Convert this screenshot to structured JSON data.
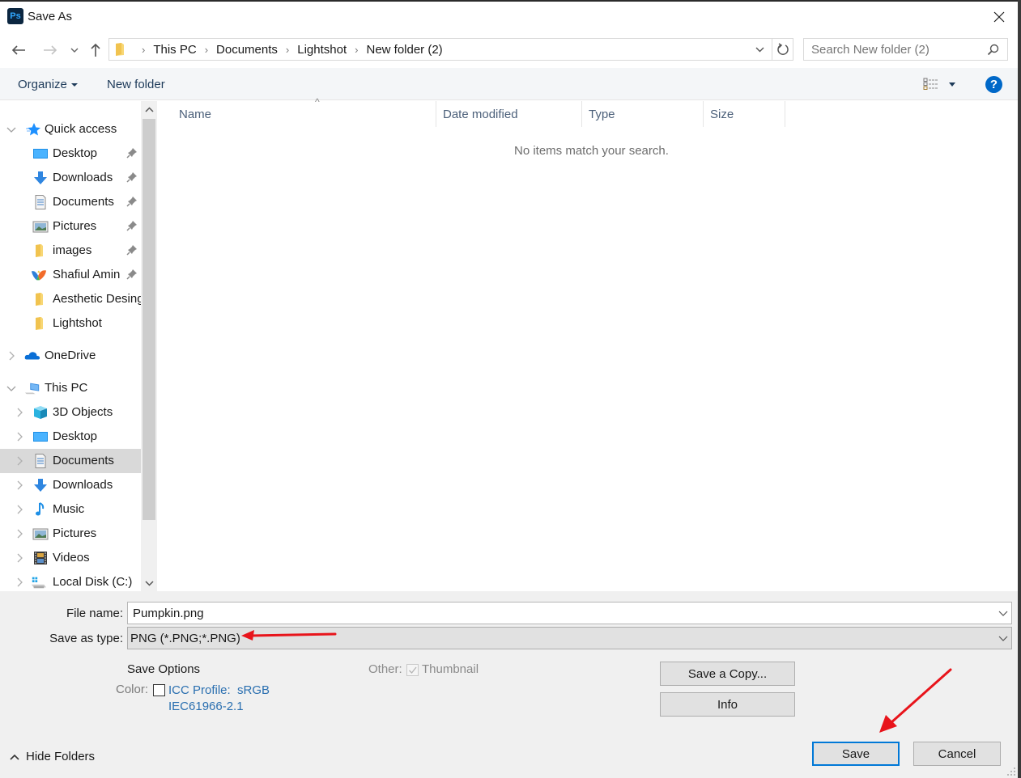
{
  "window": {
    "title": "Save As",
    "app_icon_text": "Ps"
  },
  "nav": {
    "breadcrumbs": [
      "This PC",
      "Documents",
      "Lightshot",
      "New folder (2)"
    ],
    "search_placeholder": "Search New folder (2)"
  },
  "toolbar": {
    "organize_label": "Organize",
    "new_folder_label": "New folder",
    "help_label": "?"
  },
  "sidebar": {
    "quick_access": {
      "label": "Quick access",
      "items": [
        {
          "label": "Desktop",
          "icon": "desktop-icon",
          "pinned": true
        },
        {
          "label": "Downloads",
          "icon": "downloads-icon",
          "pinned": true
        },
        {
          "label": "Documents",
          "icon": "documents-icon",
          "pinned": true
        },
        {
          "label": "Pictures",
          "icon": "pictures-icon",
          "pinned": true
        },
        {
          "label": "images",
          "icon": "folder-icon",
          "pinned": true
        },
        {
          "label": "Shafiul Amin",
          "icon": "user-folder-icon",
          "pinned": true
        },
        {
          "label": "Aesthetic Desing",
          "icon": "folder-icon",
          "pinned": false
        },
        {
          "label": "Lightshot",
          "icon": "folder-icon",
          "pinned": false
        }
      ]
    },
    "onedrive": {
      "label": "OneDrive"
    },
    "this_pc": {
      "label": "This PC",
      "items": [
        {
          "label": "3D Objects",
          "icon": "3d-objects-icon"
        },
        {
          "label": "Desktop",
          "icon": "desktop-icon"
        },
        {
          "label": "Documents",
          "icon": "documents-icon",
          "selected": true
        },
        {
          "label": "Downloads",
          "icon": "downloads-icon"
        },
        {
          "label": "Music",
          "icon": "music-icon"
        },
        {
          "label": "Pictures",
          "icon": "pictures-icon"
        },
        {
          "label": "Videos",
          "icon": "videos-icon"
        },
        {
          "label": "Local Disk (C:)",
          "icon": "local-disk-icon"
        }
      ]
    }
  },
  "filelist": {
    "columns": [
      "Name",
      "Date modified",
      "Type",
      "Size"
    ],
    "empty_message": "No items match your search."
  },
  "form": {
    "file_name_label": "File name:",
    "file_name_value": "Pumpkin.png",
    "save_as_type_label": "Save as type:",
    "save_as_type_value": "PNG (*.PNG;*.PNG)",
    "save_options_label": "Save Options",
    "color_label": "Color:",
    "icc_profile_line1": "ICC Profile:  sRGB",
    "icc_profile_line2": "IEC61966-2.1",
    "icc_checked": false,
    "other_label": "Other:",
    "thumbnail_label": "Thumbnail",
    "thumbnail_checked": true
  },
  "buttons": {
    "save_copy": "Save a Copy...",
    "info": "Info",
    "save": "Save",
    "cancel": "Cancel",
    "hide_folders": "Hide Folders"
  },
  "colors": {
    "accent": "#0078d7",
    "link": "#2a6fb0",
    "annotation_arrow": "#e8141b"
  }
}
